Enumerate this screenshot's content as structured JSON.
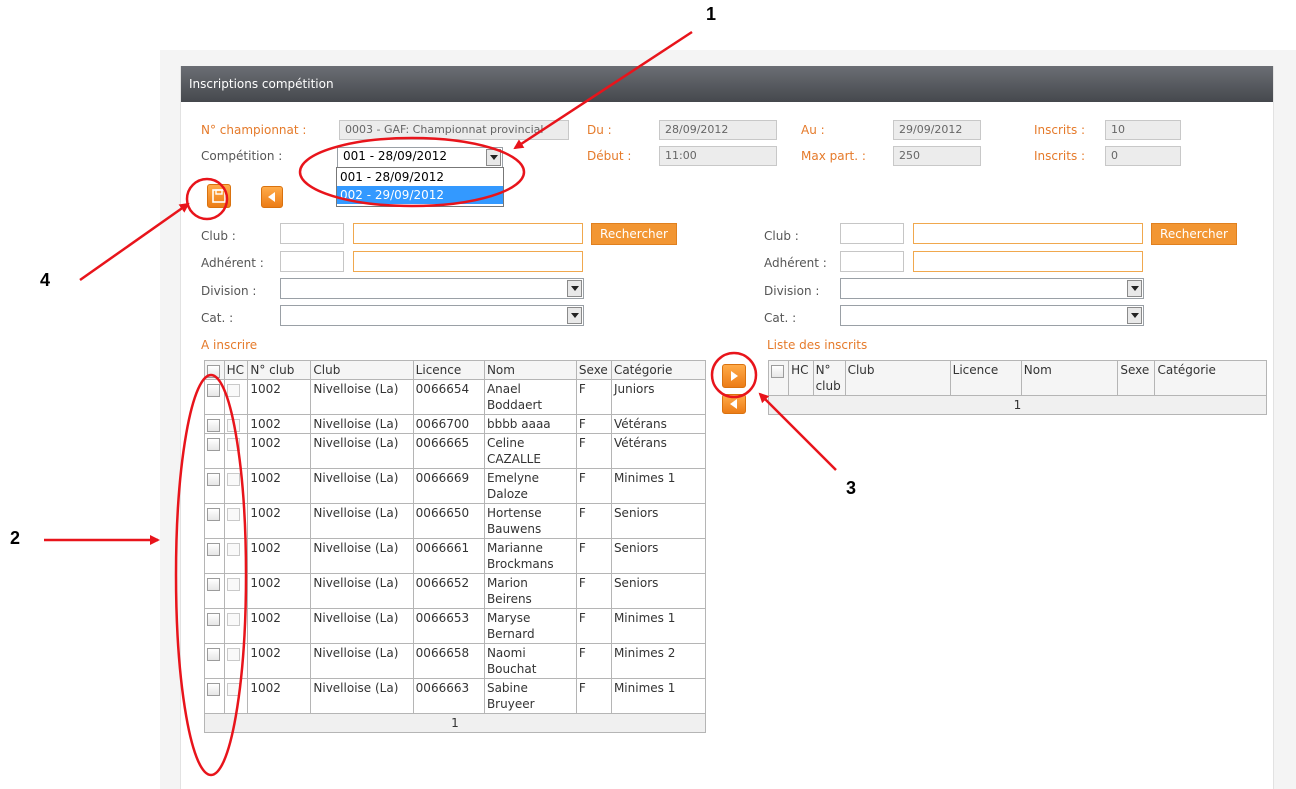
{
  "window": {
    "title": "Inscriptions compétition"
  },
  "header": {
    "championnat_label": "N° championnat :",
    "championnat_value": "0003 - GAF: Championnat provincial",
    "competition_label": "Compétition :",
    "competition_value": "001 - 28/09/2012",
    "competition_options": [
      "001 - 28/09/2012",
      "002 - 29/09/2012"
    ],
    "du_label": "Du :",
    "du_value": "28/09/2012",
    "debut_label": "Début :",
    "debut_value": "11:00",
    "au_label": "Au :",
    "au_value": "29/09/2012",
    "maxpart_label": "Max part. :",
    "maxpart_value": "250",
    "inscrits_label": "Inscrits :",
    "inscrits_value1": "10",
    "inscrits_label2": "Inscrits :",
    "inscrits_value2": "0"
  },
  "left_filters": {
    "club_label": "Club :",
    "adherent_label": "Adhérent :",
    "division_label": "Division :",
    "cat_label": "Cat. :",
    "search_button": "Rechercher"
  },
  "right_filters": {
    "club_label": "Club :",
    "adherent_label": "Adhérent :",
    "division_label": "Division :",
    "cat_label": "Cat. :",
    "search_button": "Rechercher"
  },
  "left_table": {
    "title": "A inscrire",
    "columns": [
      "HC",
      "N° club",
      "Club",
      "Licence",
      "Nom",
      "Sexe",
      "Catégorie"
    ],
    "rows": [
      [
        "1002",
        "Nivelloise (La)",
        "0066654",
        "Anael Boddaert",
        "F",
        "Juniors"
      ],
      [
        "1002",
        "Nivelloise (La)",
        "0066700",
        "bbbb aaaa",
        "F",
        "Vétérans"
      ],
      [
        "1002",
        "Nivelloise (La)",
        "0066665",
        "Celine CAZALLE",
        "F",
        "Vétérans"
      ],
      [
        "1002",
        "Nivelloise (La)",
        "0066669",
        "Emelyne Daloze",
        "F",
        "Minimes 1"
      ],
      [
        "1002",
        "Nivelloise (La)",
        "0066650",
        "Hortense Bauwens",
        "F",
        "Seniors"
      ],
      [
        "1002",
        "Nivelloise (La)",
        "0066661",
        "Marianne Brockmans",
        "F",
        "Seniors"
      ],
      [
        "1002",
        "Nivelloise (La)",
        "0066652",
        "Marion Beirens",
        "F",
        "Seniors"
      ],
      [
        "1002",
        "Nivelloise (La)",
        "0066653",
        "Maryse Bernard",
        "F",
        "Minimes 1"
      ],
      [
        "1002",
        "Nivelloise (La)",
        "0066658",
        "Naomi Bouchat",
        "F",
        "Minimes 2"
      ],
      [
        "1002",
        "Nivelloise (La)",
        "0066663",
        "Sabine Bruyeer",
        "F",
        "Minimes 1"
      ]
    ],
    "pager": "1"
  },
  "right_table": {
    "title": "Liste des inscrits",
    "columns": [
      "HC",
      "N° club",
      "Club",
      "Licence",
      "Nom",
      "Sexe",
      "Catégorie"
    ],
    "pager": "1"
  },
  "annotations": {
    "n1": "1",
    "n2": "2",
    "n3": "3",
    "n4": "4"
  },
  "colors": {
    "accent": "#f29633",
    "label_orange": "#e57a2a",
    "annotation_red": "#e8141b"
  }
}
